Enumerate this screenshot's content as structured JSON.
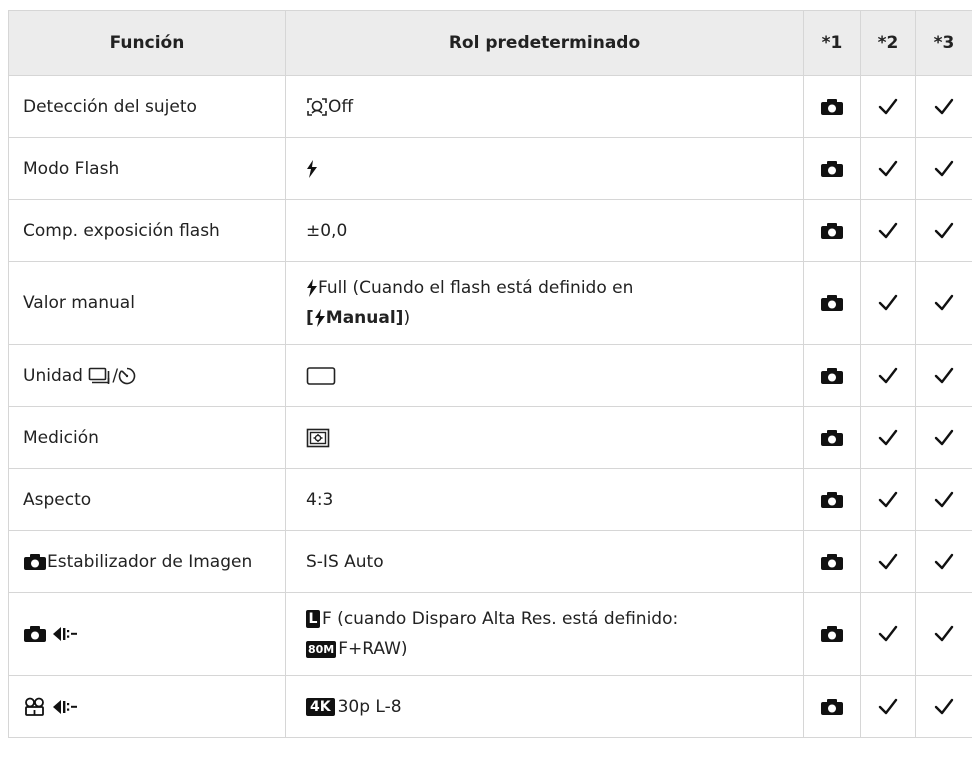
{
  "table": {
    "headers": {
      "funcion": "Función",
      "rol": "Rol predeterminado",
      "n1": "*1",
      "n2": "*2",
      "n3": "*3"
    },
    "rows": [
      {
        "func": "Detección del sujeto",
        "val": "Off"
      },
      {
        "func": "Modo Flash"
      },
      {
        "func": "Comp. exposición flash",
        "val": "±0,0"
      },
      {
        "func": "Valor manual",
        "val_a": "Full (Cuando el flash está definido en",
        "val_b_open": "[",
        "val_b_bold": "Manual]",
        "val_b_close": ")"
      },
      {
        "func": "Unidad",
        "func_sep": "/"
      },
      {
        "func": "Medición"
      },
      {
        "func": "Aspecto",
        "val": "4:3"
      },
      {
        "func": "Estabilizador de Imagen",
        "val": "S-IS Auto"
      },
      {
        "val_badge": "L",
        "val_a": "F (cuando Disparo Alta Res. está definido:",
        "val_badge2": "80M",
        "val_b": "F+RAW)"
      },
      {
        "val_badge": "4K",
        "val": "30p L-8"
      }
    ],
    "marks": {
      "col1": "camera-icon",
      "col2": "check-icon",
      "col3": "check-icon"
    }
  }
}
